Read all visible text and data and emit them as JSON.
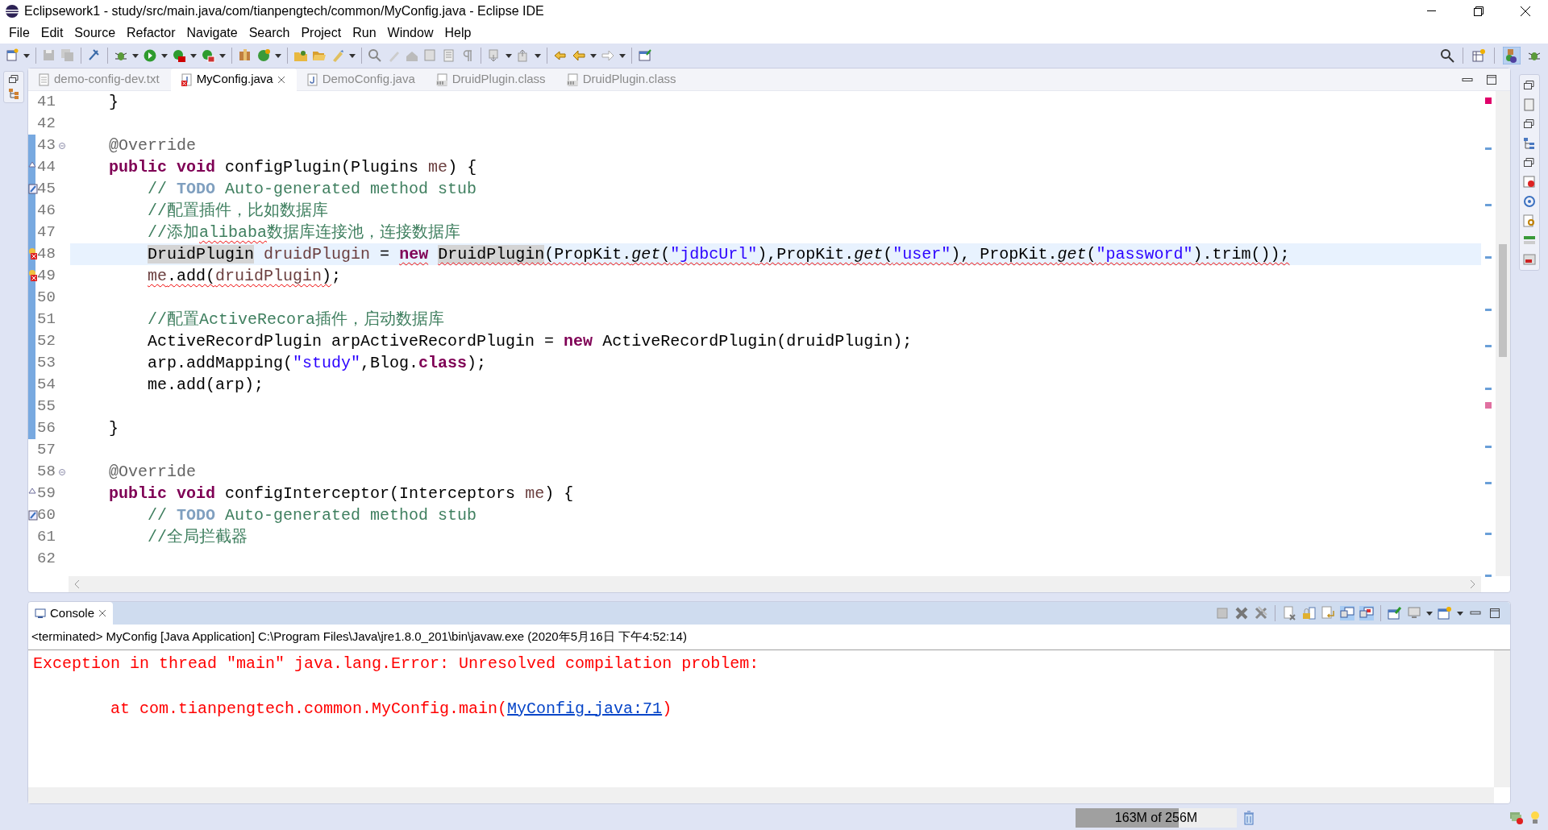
{
  "window": {
    "title": "Eclipsework1 - study/src/main.java/com/tianpengtech/common/MyConfig.java - Eclipse IDE"
  },
  "menu": [
    "File",
    "Edit",
    "Source",
    "Refactor",
    "Navigate",
    "Search",
    "Project",
    "Run",
    "Window",
    "Help"
  ],
  "editor_tabs": [
    {
      "label": "demo-config-dev.txt",
      "kind": "text",
      "selected": false
    },
    {
      "label": "MyConfig.java",
      "kind": "java-error",
      "selected": true
    },
    {
      "label": "DemoConfig.java",
      "kind": "java",
      "selected": false
    },
    {
      "label": "DruidPlugin.class",
      "kind": "class",
      "selected": false
    },
    {
      "label": "DruidPlugin.class",
      "kind": "class",
      "selected": false
    }
  ],
  "code_lines": [
    {
      "number": "41",
      "changed": false,
      "current": false,
      "tokens": [
        {
          "text": "    }",
          "kind": "plain"
        }
      ]
    },
    {
      "number": "42",
      "changed": false,
      "current": false
    },
    {
      "number": "43",
      "annotation": {
        "kind": "fold"
      },
      "changed": true,
      "current": false,
      "tokens": [
        {
          "text": "    @Override",
          "kind": "ann"
        }
      ]
    },
    {
      "number": "44",
      "annotation": {
        "kind": "override"
      },
      "changed": true,
      "current": false,
      "tokens": [
        {
          "text": "    public void",
          "kind": "kw"
        },
        {
          "text": " configPlugin(Plugins ",
          "kind": "plain"
        },
        {
          "text": "me",
          "kind": "local"
        },
        {
          "text": ") {",
          "kind": "plain"
        }
      ]
    },
    {
      "number": "45",
      "annotation": {
        "kind": "task"
      },
      "changed": true,
      "current": false,
      "tokens": [
        {
          "text": "        // ",
          "kind": "comment"
        },
        {
          "text": "TODO",
          "kind": "todo"
        },
        {
          "text": " Auto-generated method stub",
          "kind": "comment"
        }
      ]
    },
    {
      "number": "46",
      "changed": true,
      "current": false,
      "tokens": [
        {
          "text": "        //配置插件，比如数据库",
          "kind": "comment"
        }
      ]
    },
    {
      "number": "47",
      "changed": true,
      "current": false,
      "tokens": [
        {
          "text": "        //添加",
          "kind": "comment"
        },
        {
          "text": "alibaba",
          "kind": "comment",
          "squiggle": true
        },
        {
          "text": "数据库连接池，连接数据库",
          "kind": "comment"
        }
      ]
    },
    {
      "number": "48",
      "annotation": {
        "kind": "error"
      },
      "changed": true,
      "current": true,
      "tokens": [
        {
          "text": "        DruidPlugin",
          "kind": "occurrence"
        },
        {
          "text": " druidPlugin",
          "kind": "local"
        },
        {
          "text": " = ",
          "kind": "plain"
        },
        {
          "text": "new",
          "kind": "kw",
          "squiggle": true
        },
        {
          "text": " DruidPlugin",
          "kind": "occurrence",
          "squiggle": true
        },
        {
          "text": "(PropKit.",
          "kind": "plain",
          "squiggle": true
        },
        {
          "text": "get",
          "kind": "static",
          "squiggle": true
        },
        {
          "text": "(",
          "kind": "plain",
          "squiggle": true
        },
        {
          "text": "\"jdbcUrl\"",
          "kind": "str",
          "squiggle": true
        },
        {
          "text": "),PropKit.",
          "kind": "plain",
          "squiggle": true
        },
        {
          "text": "get",
          "kind": "static",
          "squiggle": true
        },
        {
          "text": "(",
          "kind": "plain",
          "squiggle": true
        },
        {
          "text": "\"user\"",
          "kind": "str",
          "squiggle": true
        },
        {
          "text": "), PropKit.",
          "kind": "plain",
          "squiggle": true
        },
        {
          "text": "get",
          "kind": "static",
          "squiggle": true
        },
        {
          "text": "(",
          "kind": "plain",
          "squiggle": true
        },
        {
          "text": "\"password\"",
          "kind": "str",
          "squiggle": true
        },
        {
          "text": ").trim());",
          "kind": "plain",
          "squiggle": true
        }
      ]
    },
    {
      "number": "49",
      "annotation": {
        "kind": "error"
      },
      "changed": true,
      "current": false,
      "tokens": [
        {
          "text": "        me",
          "kind": "local",
          "squiggle": true
        },
        {
          "text": ".add(",
          "kind": "plain",
          "squiggle": true
        },
        {
          "text": "druidPlugin",
          "kind": "local",
          "squiggle": true
        },
        {
          "text": ")",
          "kind": "plain",
          "squiggle": true
        },
        {
          "text": ";",
          "kind": "plain"
        }
      ]
    },
    {
      "number": "50",
      "changed": true,
      "current": false
    },
    {
      "number": "51",
      "changed": true,
      "current": false,
      "tokens": [
        {
          "text": "        //配置ActiveRecora插件，启动数据库",
          "kind": "comment"
        }
      ]
    },
    {
      "number": "52",
      "changed": true,
      "current": false,
      "tokens": [
        {
          "text": "        ActiveRecordPlugin arpActiveRecordPlugin = ",
          "kind": "plain"
        },
        {
          "text": "new",
          "kind": "kw"
        },
        {
          "text": " ActiveRecordPlugin(druidPlugin);",
          "kind": "plain"
        }
      ]
    },
    {
      "number": "53",
      "changed": true,
      "current": false,
      "tokens": [
        {
          "text": "        arp.addMapping(",
          "kind": "plain"
        },
        {
          "text": "\"study\"",
          "kind": "str"
        },
        {
          "text": ",Blog.",
          "kind": "plain"
        },
        {
          "text": "class",
          "kind": "kw"
        },
        {
          "text": ");",
          "kind": "plain"
        }
      ]
    },
    {
      "number": "54",
      "changed": true,
      "current": false,
      "tokens": [
        {
          "text": "        me.add(arp);",
          "kind": "plain"
        }
      ]
    },
    {
      "number": "55",
      "changed": true,
      "current": false
    },
    {
      "number": "56",
      "changed": true,
      "current": false,
      "tokens": [
        {
          "text": "    }",
          "kind": "plain"
        }
      ]
    },
    {
      "number": "57",
      "changed": false,
      "current": false
    },
    {
      "number": "58",
      "annotation": {
        "kind": "fold"
      },
      "changed": false,
      "current": false,
      "tokens": [
        {
          "text": "    @Override",
          "kind": "ann"
        }
      ]
    },
    {
      "number": "59",
      "annotation": {
        "kind": "override"
      },
      "changed": false,
      "current": false,
      "tokens": [
        {
          "text": "    public void",
          "kind": "kw"
        },
        {
          "text": " configInterceptor(Interceptors ",
          "kind": "plain"
        },
        {
          "text": "me",
          "kind": "local"
        },
        {
          "text": ") {",
          "kind": "plain"
        }
      ]
    },
    {
      "number": "60",
      "annotation": {
        "kind": "task"
      },
      "changed": false,
      "current": false,
      "tokens": [
        {
          "text": "        // ",
          "kind": "comment"
        },
        {
          "text": "TODO",
          "kind": "todo"
        },
        {
          "text": " Auto-generated method stub",
          "kind": "comment"
        }
      ]
    },
    {
      "number": "61",
      "changed": false,
      "current": false,
      "tokens": [
        {
          "text": "        //全局拦截器",
          "kind": "comment"
        }
      ]
    },
    {
      "number": "62",
      "changed": false,
      "current": false
    }
  ],
  "console": {
    "tab": "Console",
    "header": "<terminated> MyConfig [Java Application] C:\\Program Files\\Java\\jre1.8.0_201\\bin\\javaw.exe (2020年5月16日 下午4:52:14)",
    "lines": [
      {
        "kind": "error",
        "text": "Exception in thread \"main\" java.lang.Error: Unresolved compilation problem:"
      },
      {
        "kind": "stack",
        "text": "at com.tianpengtech.common.MyConfig.main(",
        "link": "MyConfig.java:71",
        "after": ")"
      }
    ]
  },
  "status_bar": {
    "memory": {
      "text": "163M of 256M",
      "level": 0.64
    }
  }
}
